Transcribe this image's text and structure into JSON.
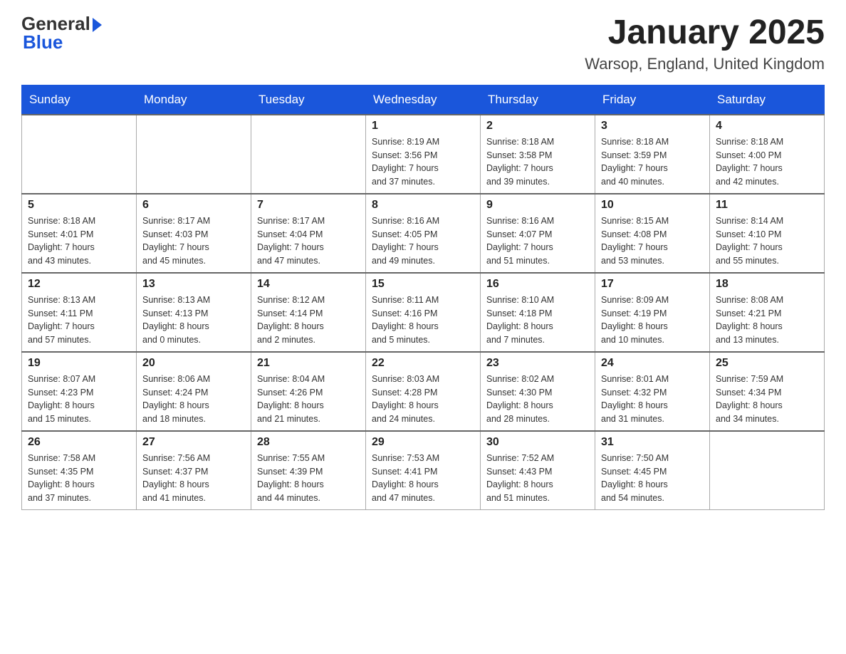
{
  "header": {
    "logo": {
      "general": "General",
      "arrow": "▶",
      "blue": "Blue"
    },
    "title": "January 2025",
    "location": "Warsop, England, United Kingdom"
  },
  "calendar": {
    "days_of_week": [
      "Sunday",
      "Monday",
      "Tuesday",
      "Wednesday",
      "Thursday",
      "Friday",
      "Saturday"
    ],
    "weeks": [
      [
        {
          "day": "",
          "info": ""
        },
        {
          "day": "",
          "info": ""
        },
        {
          "day": "",
          "info": ""
        },
        {
          "day": "1",
          "info": "Sunrise: 8:19 AM\nSunset: 3:56 PM\nDaylight: 7 hours\nand 37 minutes."
        },
        {
          "day": "2",
          "info": "Sunrise: 8:18 AM\nSunset: 3:58 PM\nDaylight: 7 hours\nand 39 minutes."
        },
        {
          "day": "3",
          "info": "Sunrise: 8:18 AM\nSunset: 3:59 PM\nDaylight: 7 hours\nand 40 minutes."
        },
        {
          "day": "4",
          "info": "Sunrise: 8:18 AM\nSunset: 4:00 PM\nDaylight: 7 hours\nand 42 minutes."
        }
      ],
      [
        {
          "day": "5",
          "info": "Sunrise: 8:18 AM\nSunset: 4:01 PM\nDaylight: 7 hours\nand 43 minutes."
        },
        {
          "day": "6",
          "info": "Sunrise: 8:17 AM\nSunset: 4:03 PM\nDaylight: 7 hours\nand 45 minutes."
        },
        {
          "day": "7",
          "info": "Sunrise: 8:17 AM\nSunset: 4:04 PM\nDaylight: 7 hours\nand 47 minutes."
        },
        {
          "day": "8",
          "info": "Sunrise: 8:16 AM\nSunset: 4:05 PM\nDaylight: 7 hours\nand 49 minutes."
        },
        {
          "day": "9",
          "info": "Sunrise: 8:16 AM\nSunset: 4:07 PM\nDaylight: 7 hours\nand 51 minutes."
        },
        {
          "day": "10",
          "info": "Sunrise: 8:15 AM\nSunset: 4:08 PM\nDaylight: 7 hours\nand 53 minutes."
        },
        {
          "day": "11",
          "info": "Sunrise: 8:14 AM\nSunset: 4:10 PM\nDaylight: 7 hours\nand 55 minutes."
        }
      ],
      [
        {
          "day": "12",
          "info": "Sunrise: 8:13 AM\nSunset: 4:11 PM\nDaylight: 7 hours\nand 57 minutes."
        },
        {
          "day": "13",
          "info": "Sunrise: 8:13 AM\nSunset: 4:13 PM\nDaylight: 8 hours\nand 0 minutes."
        },
        {
          "day": "14",
          "info": "Sunrise: 8:12 AM\nSunset: 4:14 PM\nDaylight: 8 hours\nand 2 minutes."
        },
        {
          "day": "15",
          "info": "Sunrise: 8:11 AM\nSunset: 4:16 PM\nDaylight: 8 hours\nand 5 minutes."
        },
        {
          "day": "16",
          "info": "Sunrise: 8:10 AM\nSunset: 4:18 PM\nDaylight: 8 hours\nand 7 minutes."
        },
        {
          "day": "17",
          "info": "Sunrise: 8:09 AM\nSunset: 4:19 PM\nDaylight: 8 hours\nand 10 minutes."
        },
        {
          "day": "18",
          "info": "Sunrise: 8:08 AM\nSunset: 4:21 PM\nDaylight: 8 hours\nand 13 minutes."
        }
      ],
      [
        {
          "day": "19",
          "info": "Sunrise: 8:07 AM\nSunset: 4:23 PM\nDaylight: 8 hours\nand 15 minutes."
        },
        {
          "day": "20",
          "info": "Sunrise: 8:06 AM\nSunset: 4:24 PM\nDaylight: 8 hours\nand 18 minutes."
        },
        {
          "day": "21",
          "info": "Sunrise: 8:04 AM\nSunset: 4:26 PM\nDaylight: 8 hours\nand 21 minutes."
        },
        {
          "day": "22",
          "info": "Sunrise: 8:03 AM\nSunset: 4:28 PM\nDaylight: 8 hours\nand 24 minutes."
        },
        {
          "day": "23",
          "info": "Sunrise: 8:02 AM\nSunset: 4:30 PM\nDaylight: 8 hours\nand 28 minutes."
        },
        {
          "day": "24",
          "info": "Sunrise: 8:01 AM\nSunset: 4:32 PM\nDaylight: 8 hours\nand 31 minutes."
        },
        {
          "day": "25",
          "info": "Sunrise: 7:59 AM\nSunset: 4:34 PM\nDaylight: 8 hours\nand 34 minutes."
        }
      ],
      [
        {
          "day": "26",
          "info": "Sunrise: 7:58 AM\nSunset: 4:35 PM\nDaylight: 8 hours\nand 37 minutes."
        },
        {
          "day": "27",
          "info": "Sunrise: 7:56 AM\nSunset: 4:37 PM\nDaylight: 8 hours\nand 41 minutes."
        },
        {
          "day": "28",
          "info": "Sunrise: 7:55 AM\nSunset: 4:39 PM\nDaylight: 8 hours\nand 44 minutes."
        },
        {
          "day": "29",
          "info": "Sunrise: 7:53 AM\nSunset: 4:41 PM\nDaylight: 8 hours\nand 47 minutes."
        },
        {
          "day": "30",
          "info": "Sunrise: 7:52 AM\nSunset: 4:43 PM\nDaylight: 8 hours\nand 51 minutes."
        },
        {
          "day": "31",
          "info": "Sunrise: 7:50 AM\nSunset: 4:45 PM\nDaylight: 8 hours\nand 54 minutes."
        },
        {
          "day": "",
          "info": ""
        }
      ]
    ]
  }
}
